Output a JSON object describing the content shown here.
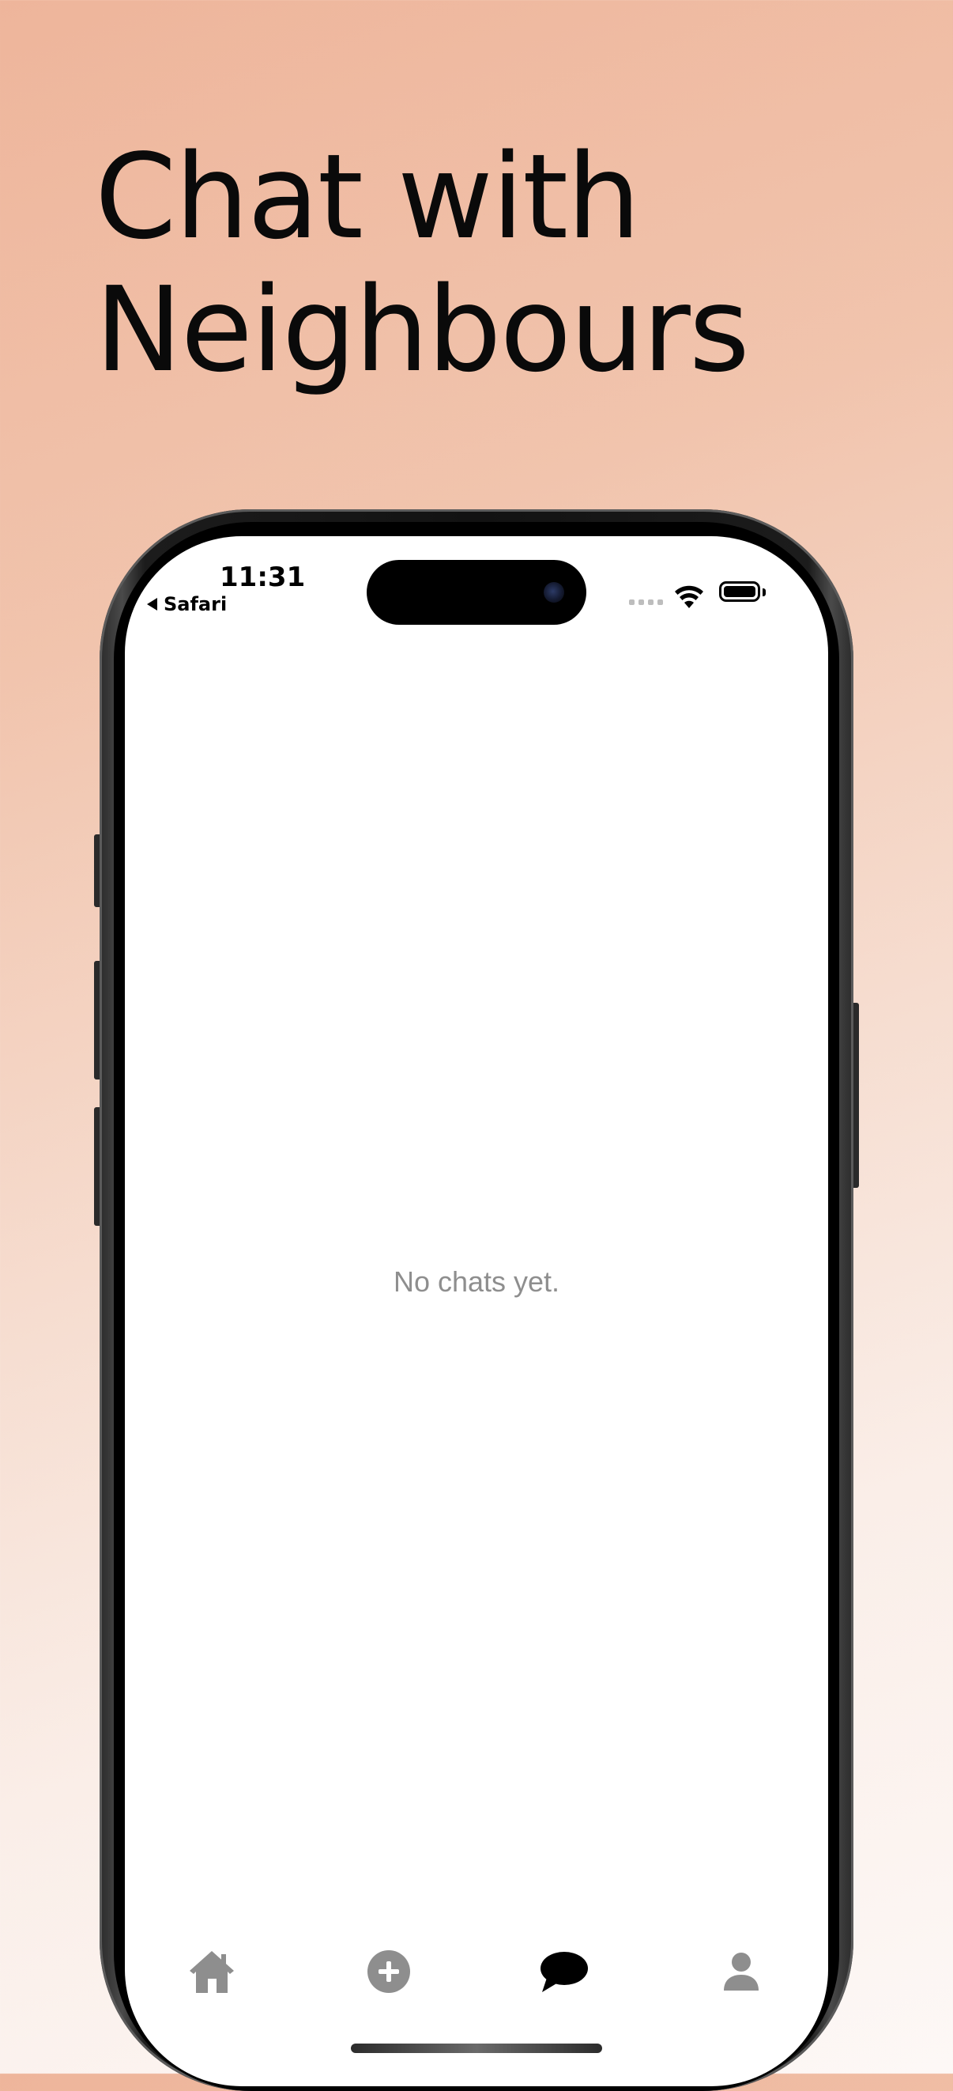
{
  "headline": {
    "line1": "Chat with",
    "line2": "Neighbours"
  },
  "status_bar": {
    "time": "11:31",
    "back_app": "Safari",
    "battery_level": 1.0
  },
  "main": {
    "empty_message": "No chats yet."
  },
  "tab_bar": {
    "active": "chat",
    "active_color": "#000000",
    "inactive_color": "#8e8e8e",
    "items": [
      {
        "id": "home",
        "icon": "home-icon"
      },
      {
        "id": "add",
        "icon": "add-circle-icon"
      },
      {
        "id": "chat",
        "icon": "chat-bubble-icon"
      },
      {
        "id": "profile",
        "icon": "person-icon"
      }
    ]
  },
  "colors": {
    "background_top": "#eeb59b",
    "background_bottom": "#fdf8f6",
    "text": "#0a0a0a"
  }
}
